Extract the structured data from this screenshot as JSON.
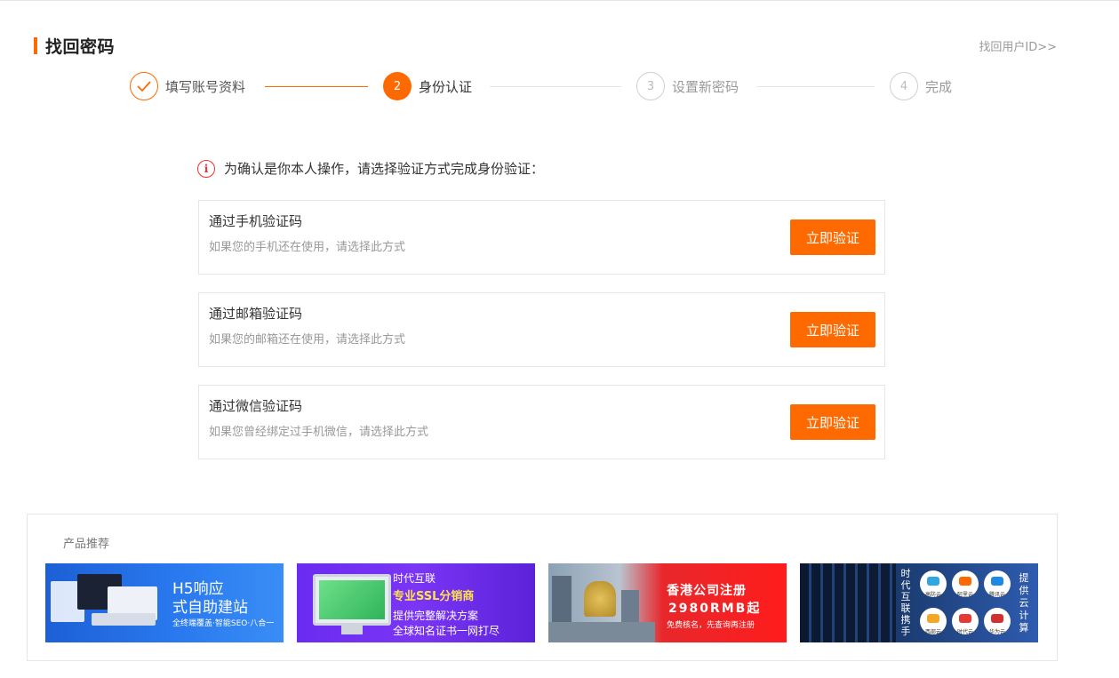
{
  "header": {
    "title": "找回密码",
    "find_user_id": "找回用户ID>>",
    "accent_color": "#ff6a00"
  },
  "steps": [
    {
      "number": "✓",
      "label": "填写账号资料",
      "state": "done"
    },
    {
      "number": "2",
      "label": "身份认证",
      "state": "active"
    },
    {
      "number": "3",
      "label": "设置新密码",
      "state": "todo"
    },
    {
      "number": "4",
      "label": "完成",
      "state": "todo"
    }
  ],
  "notice": {
    "icon": "info-icon",
    "text": "为确认是你本人操作，请选择验证方式完成身份验证："
  },
  "options": [
    {
      "title": "通过手机验证码",
      "desc": "如果您的手机还在使用，请选择此方式",
      "button": "立即验证"
    },
    {
      "title": "通过邮箱验证码",
      "desc": "如果您的邮箱还在使用，请选择此方式",
      "button": "立即验证"
    },
    {
      "title": "通过微信验证码",
      "desc": "如果您曾经绑定过手机微信，请选择此方式",
      "button": "立即验证"
    }
  ],
  "products": {
    "title": "产品推荐",
    "banners": [
      {
        "line1": "H5响应",
        "line2": "式自助建站",
        "line3": "全终端覆盖·智能SEO·八合一"
      },
      {
        "line1": "时代互联",
        "line2": "专业SSL分销商",
        "line3": "提供完整解决方案",
        "line4": "全球知名证书一网打尽"
      },
      {
        "line1": "香港公司注册",
        "line2": "2980RMB起",
        "line3": "免费核名，先查询再注册"
      },
      {
        "vertical1": "时代互联携手",
        "vertical2": "提供云计算",
        "logos": [
          "高防云",
          "阿里云",
          "腾讯云",
          "西部云",
          "时代云",
          "华为云"
        ]
      }
    ]
  }
}
